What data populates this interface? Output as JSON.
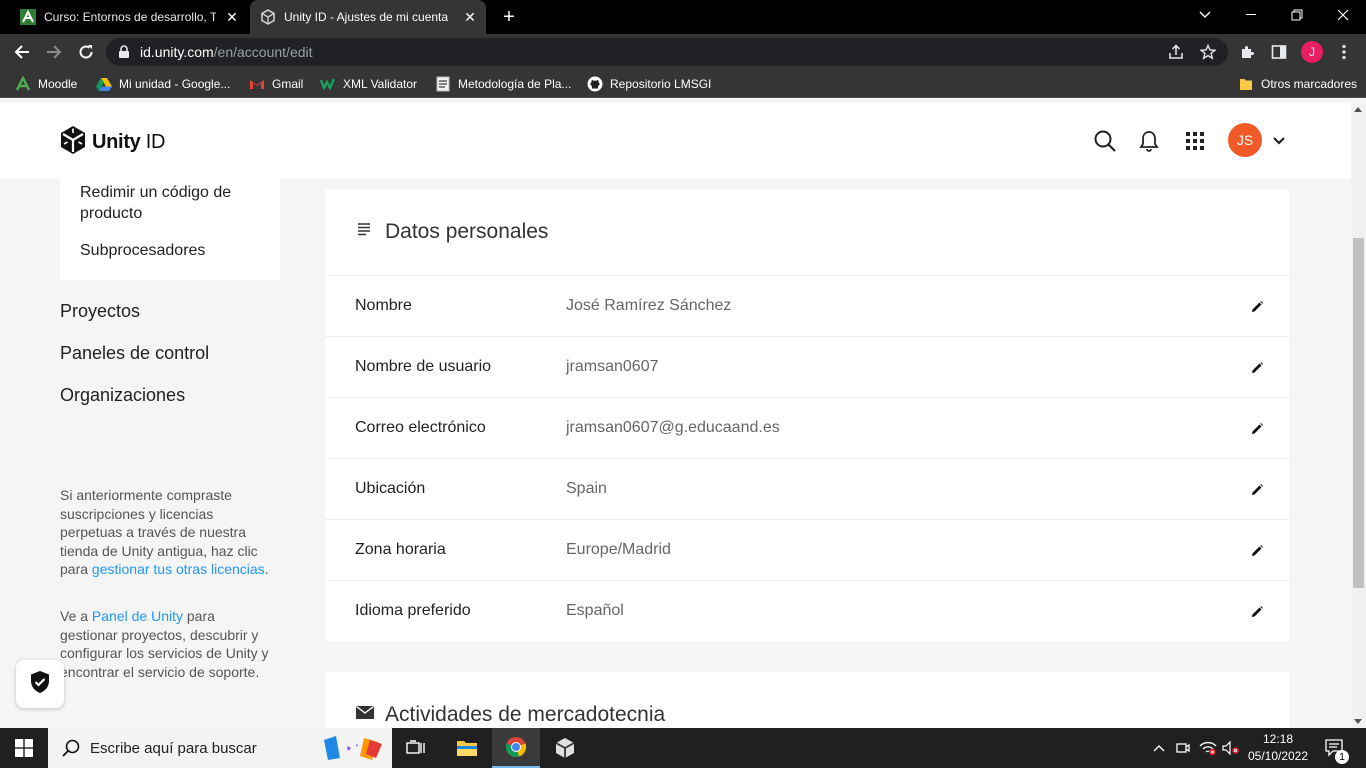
{
  "browser": {
    "tabs": [
      {
        "title": "Curso: Entornos de desarrollo, Te",
        "active": false
      },
      {
        "title": "Unity ID - Ajustes de mi cuenta",
        "active": true
      }
    ],
    "url_host": "id.unity.com",
    "url_path": "/en/account/edit",
    "profile_initial": "J",
    "bookmarks": [
      {
        "label": "Moodle",
        "icon": "moodle-icon"
      },
      {
        "label": "Mi unidad - Google...",
        "icon": "google-drive-icon"
      },
      {
        "label": "Gmail",
        "icon": "gmail-icon"
      },
      {
        "label": "XML Validator",
        "icon": "xml-validator-icon"
      },
      {
        "label": "Metodología de Pla...",
        "icon": "document-icon"
      },
      {
        "label": "Repositorio LMSGI",
        "icon": "github-icon"
      }
    ],
    "other_bookmarks": "Otros marcadores"
  },
  "header": {
    "logo_text": "Unity",
    "logo_suffix": "ID",
    "avatar_initials": "JS"
  },
  "sidebar": {
    "card_links": [
      "Redimir un código de producto",
      "Subprocesadores"
    ],
    "nav": [
      "Proyectos",
      "Paneles de control",
      "Organizaciones"
    ],
    "note1": {
      "text": "Si anteriormente compraste suscripciones y licencias perpetuas a través de nuestra tienda de Unity antigua, haz clic para ",
      "link": "gestionar tus otras licencias",
      "after": "."
    },
    "note2": {
      "before": "Ve a ",
      "link": "Panel de Unity",
      "after": " para gestionar proyectos, descubrir y configurar los servicios de Unity y encontrar el servicio de soporte."
    }
  },
  "personal_data": {
    "title": "Datos personales",
    "rows": [
      {
        "label": "Nombre",
        "value": "José Ramírez Sánchez"
      },
      {
        "label": "Nombre de usuario",
        "value": "jramsan0607"
      },
      {
        "label": "Correo electrónico",
        "value": "jramsan0607@g.educaand.es"
      },
      {
        "label": "Ubicación",
        "value": "Spain"
      },
      {
        "label": "Zona horaria",
        "value": "Europe/Madrid"
      },
      {
        "label": "Idioma preferido",
        "value": "Español"
      }
    ]
  },
  "marketing": {
    "title": "Actividades de mercadotecnia"
  },
  "taskbar": {
    "search_placeholder": "Escribe aquí para buscar",
    "time": "12:18",
    "date": "05/10/2022",
    "notification_count": "1"
  },
  "colors": {
    "link": "#2196f3",
    "avatar": "#f05a28",
    "profile": "#e91e63"
  }
}
